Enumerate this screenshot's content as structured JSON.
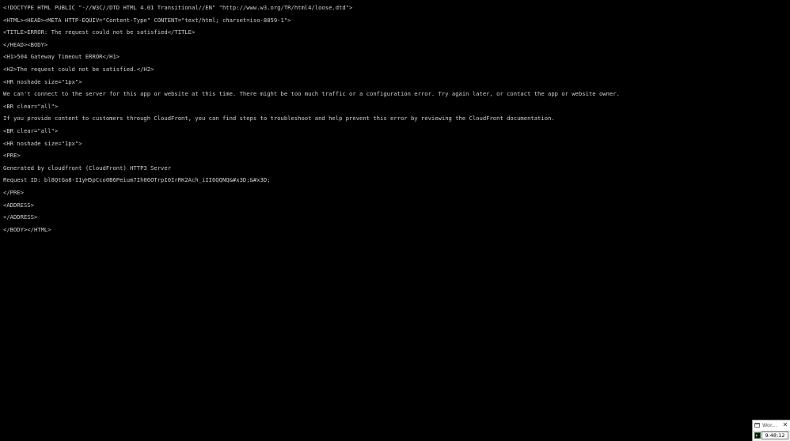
{
  "console": {
    "lines": [
      "<!DOCTYPE HTML PUBLIC \"-//W3C//DTD HTML 4.01 Transitional//EN\" \"http://www.w3.org/TR/html4/loose.dtd\">",
      "<HTML><HEAD><META HTTP-EQUIV=\"Content-Type\" CONTENT=\"text/html; charset=iso-8859-1\">",
      "<TITLE>ERROR: The request could not be satisfied</TITLE>",
      "</HEAD><BODY>",
      "<H1>504 Gateway Timeout ERROR</H1>",
      "<H2>The request could not be satisfied.</H2>",
      "<HR noshade size=\"1px\">",
      "We can't connect to the server for this app or website at this time. There might be too much traffic or a configuration error. Try again later, or contact the app or website owner.",
      "<BR clear=\"all\">",
      "If you provide content to customers through CloudFront, you can find steps to troubleshoot and help prevent this error by reviewing the CloudFront documentation.",
      "<BR clear=\"all\">",
      "<HR noshade size=\"1px\">",
      "<PRE>",
      "Generated by cloudfront (CloudFront) HTTP3 Server",
      "Request ID: bl8QtGa8-I1yH5pCco0B6Peium7Ih86OTrpI0IrRK2Ach_iII6QQNQ&#x3D;&#x3D;",
      "</PRE>",
      "<ADDRESS>",
      "</ADDRESS>",
      "</BODY></HTML>"
    ]
  },
  "tray": {
    "app_label": "Wor...",
    "close_glyph": "✕",
    "clock": "9:48:12"
  },
  "colors": {
    "background": "#000000",
    "text": "#cfcfcf"
  }
}
